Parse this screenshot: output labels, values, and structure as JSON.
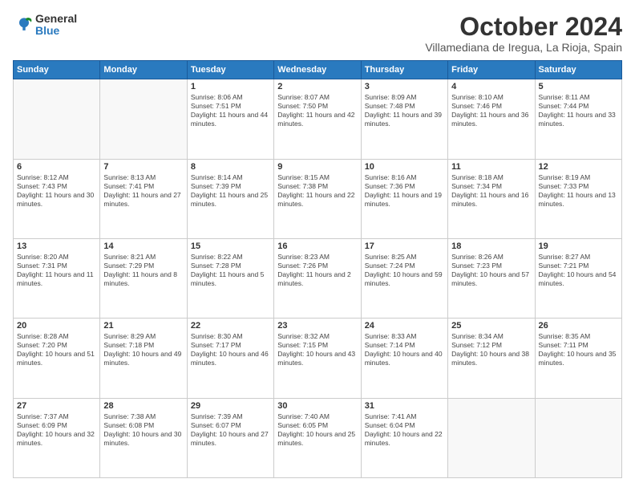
{
  "logo": {
    "general": "General",
    "blue": "Blue"
  },
  "title": "October 2024",
  "location": "Villamediana de Iregua, La Rioja, Spain",
  "weekdays": [
    "Sunday",
    "Monday",
    "Tuesday",
    "Wednesday",
    "Thursday",
    "Friday",
    "Saturday"
  ],
  "weeks": [
    [
      {
        "day": "",
        "detail": ""
      },
      {
        "day": "",
        "detail": ""
      },
      {
        "day": "1",
        "detail": "Sunrise: 8:06 AM\nSunset: 7:51 PM\nDaylight: 11 hours and 44 minutes."
      },
      {
        "day": "2",
        "detail": "Sunrise: 8:07 AM\nSunset: 7:50 PM\nDaylight: 11 hours and 42 minutes."
      },
      {
        "day": "3",
        "detail": "Sunrise: 8:09 AM\nSunset: 7:48 PM\nDaylight: 11 hours and 39 minutes."
      },
      {
        "day": "4",
        "detail": "Sunrise: 8:10 AM\nSunset: 7:46 PM\nDaylight: 11 hours and 36 minutes."
      },
      {
        "day": "5",
        "detail": "Sunrise: 8:11 AM\nSunset: 7:44 PM\nDaylight: 11 hours and 33 minutes."
      }
    ],
    [
      {
        "day": "6",
        "detail": "Sunrise: 8:12 AM\nSunset: 7:43 PM\nDaylight: 11 hours and 30 minutes."
      },
      {
        "day": "7",
        "detail": "Sunrise: 8:13 AM\nSunset: 7:41 PM\nDaylight: 11 hours and 27 minutes."
      },
      {
        "day": "8",
        "detail": "Sunrise: 8:14 AM\nSunset: 7:39 PM\nDaylight: 11 hours and 25 minutes."
      },
      {
        "day": "9",
        "detail": "Sunrise: 8:15 AM\nSunset: 7:38 PM\nDaylight: 11 hours and 22 minutes."
      },
      {
        "day": "10",
        "detail": "Sunrise: 8:16 AM\nSunset: 7:36 PM\nDaylight: 11 hours and 19 minutes."
      },
      {
        "day": "11",
        "detail": "Sunrise: 8:18 AM\nSunset: 7:34 PM\nDaylight: 11 hours and 16 minutes."
      },
      {
        "day": "12",
        "detail": "Sunrise: 8:19 AM\nSunset: 7:33 PM\nDaylight: 11 hours and 13 minutes."
      }
    ],
    [
      {
        "day": "13",
        "detail": "Sunrise: 8:20 AM\nSunset: 7:31 PM\nDaylight: 11 hours and 11 minutes."
      },
      {
        "day": "14",
        "detail": "Sunrise: 8:21 AM\nSunset: 7:29 PM\nDaylight: 11 hours and 8 minutes."
      },
      {
        "day": "15",
        "detail": "Sunrise: 8:22 AM\nSunset: 7:28 PM\nDaylight: 11 hours and 5 minutes."
      },
      {
        "day": "16",
        "detail": "Sunrise: 8:23 AM\nSunset: 7:26 PM\nDaylight: 11 hours and 2 minutes."
      },
      {
        "day": "17",
        "detail": "Sunrise: 8:25 AM\nSunset: 7:24 PM\nDaylight: 10 hours and 59 minutes."
      },
      {
        "day": "18",
        "detail": "Sunrise: 8:26 AM\nSunset: 7:23 PM\nDaylight: 10 hours and 57 minutes."
      },
      {
        "day": "19",
        "detail": "Sunrise: 8:27 AM\nSunset: 7:21 PM\nDaylight: 10 hours and 54 minutes."
      }
    ],
    [
      {
        "day": "20",
        "detail": "Sunrise: 8:28 AM\nSunset: 7:20 PM\nDaylight: 10 hours and 51 minutes."
      },
      {
        "day": "21",
        "detail": "Sunrise: 8:29 AM\nSunset: 7:18 PM\nDaylight: 10 hours and 49 minutes."
      },
      {
        "day": "22",
        "detail": "Sunrise: 8:30 AM\nSunset: 7:17 PM\nDaylight: 10 hours and 46 minutes."
      },
      {
        "day": "23",
        "detail": "Sunrise: 8:32 AM\nSunset: 7:15 PM\nDaylight: 10 hours and 43 minutes."
      },
      {
        "day": "24",
        "detail": "Sunrise: 8:33 AM\nSunset: 7:14 PM\nDaylight: 10 hours and 40 minutes."
      },
      {
        "day": "25",
        "detail": "Sunrise: 8:34 AM\nSunset: 7:12 PM\nDaylight: 10 hours and 38 minutes."
      },
      {
        "day": "26",
        "detail": "Sunrise: 8:35 AM\nSunset: 7:11 PM\nDaylight: 10 hours and 35 minutes."
      }
    ],
    [
      {
        "day": "27",
        "detail": "Sunrise: 7:37 AM\nSunset: 6:09 PM\nDaylight: 10 hours and 32 minutes."
      },
      {
        "day": "28",
        "detail": "Sunrise: 7:38 AM\nSunset: 6:08 PM\nDaylight: 10 hours and 30 minutes."
      },
      {
        "day": "29",
        "detail": "Sunrise: 7:39 AM\nSunset: 6:07 PM\nDaylight: 10 hours and 27 minutes."
      },
      {
        "day": "30",
        "detail": "Sunrise: 7:40 AM\nSunset: 6:05 PM\nDaylight: 10 hours and 25 minutes."
      },
      {
        "day": "31",
        "detail": "Sunrise: 7:41 AM\nSunset: 6:04 PM\nDaylight: 10 hours and 22 minutes."
      },
      {
        "day": "",
        "detail": ""
      },
      {
        "day": "",
        "detail": ""
      }
    ]
  ]
}
